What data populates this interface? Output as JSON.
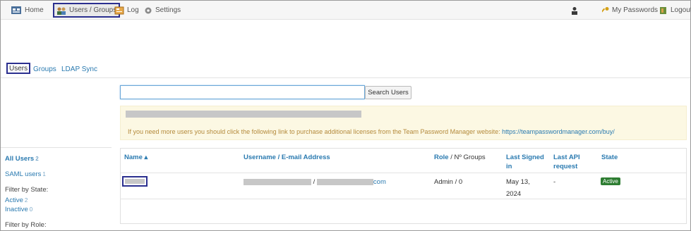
{
  "navbar": {
    "home": "Home",
    "users_groups": "Users / Groups",
    "log": "Log",
    "settings": "Settings",
    "my_passwords": "My Passwords",
    "logout": "Logout"
  },
  "subtabs": {
    "users": "Users",
    "groups": "Groups",
    "ldap_sync": "LDAP Sync"
  },
  "search": {
    "value": "",
    "button": "Search Users"
  },
  "alert": {
    "text": "If you need more users you should click the following link to purchase additional licenses from the Team Password Manager website:",
    "link": "https://teampasswordmanager.com/buy/"
  },
  "sidebar": {
    "all_users": "All Users",
    "all_users_count": "2",
    "saml_users": "SAML users",
    "saml_users_count": "1",
    "filter_state": "Filter by State:",
    "active": "Active",
    "active_count": "2",
    "inactive": "Inactive",
    "inactive_count": "0",
    "filter_role": "Filter by Role:"
  },
  "table": {
    "headers": {
      "name": "Name ▴",
      "username": "Username / E-mail Address",
      "role": "Role",
      "groups": " / Nº Groups",
      "last_signed_1": "Last Signed",
      "last_signed_2": "in",
      "last_api_1": "Last API",
      "last_api_2": "request",
      "state": "State"
    },
    "rows": [
      {
        "username_sep": "/",
        "email_suffix": "com",
        "role": "Admin / 0",
        "last_signed_1": "May 13,",
        "last_signed_2": "2024",
        "last_api": "-",
        "state": "Active"
      }
    ]
  },
  "colors": {
    "link": "#2a7ab0",
    "selection_border": "#2b2f8f",
    "alert_bg": "#fcf8e3",
    "alert_text": "#b48a3c",
    "active_badge": "#2e7d32"
  }
}
